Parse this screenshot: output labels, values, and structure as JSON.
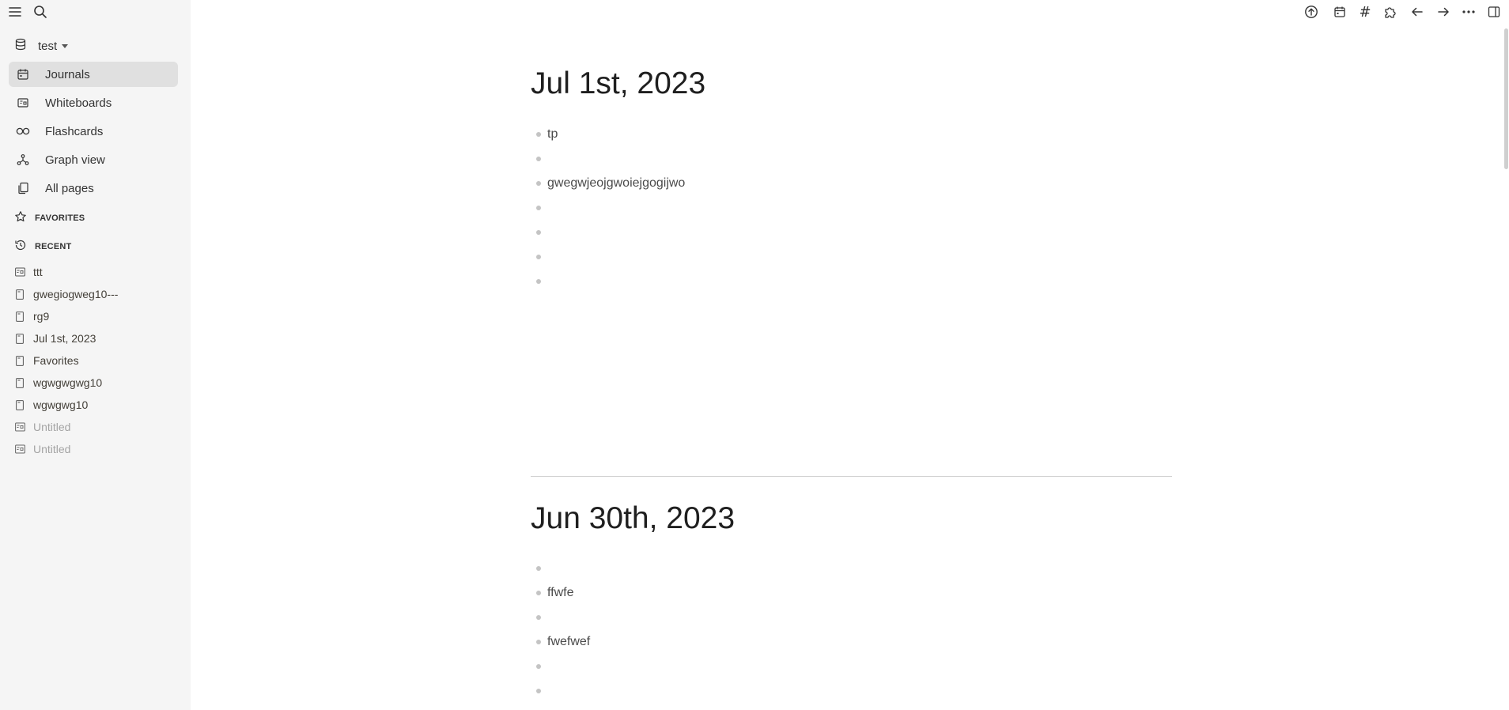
{
  "sidebar": {
    "workspace": {
      "name": "test"
    },
    "nav": [
      {
        "label": "Journals",
        "icon": "calendar-icon",
        "active": true
      },
      {
        "label": "Whiteboards",
        "icon": "whiteboard-icon",
        "active": false
      },
      {
        "label": "Flashcards",
        "icon": "infinity-icon",
        "active": false
      },
      {
        "label": "Graph view",
        "icon": "graph-icon",
        "active": false
      },
      {
        "label": "All pages",
        "icon": "pages-icon",
        "active": false
      }
    ],
    "favorites_label": "FAVORITES",
    "recent_label": "RECENT",
    "recent": [
      {
        "label": "ttt",
        "icon": "whiteboard-icon"
      },
      {
        "label": "gwegiogweg10---",
        "icon": "page-icon"
      },
      {
        "label": "rg9",
        "icon": "page-icon"
      },
      {
        "label": "Jul 1st, 2023",
        "icon": "page-icon"
      },
      {
        "label": "Favorites",
        "icon": "page-icon"
      },
      {
        "label": "wgwgwgwg10",
        "icon": "page-icon"
      },
      {
        "label": "wgwgwg10",
        "icon": "page-icon"
      },
      {
        "label": "Untitled",
        "icon": "whiteboard-icon"
      },
      {
        "label": "Untitled",
        "icon": "whiteboard-icon"
      }
    ]
  },
  "toolbar": {
    "buttons": [
      "sync-icon",
      "calendar-icon",
      "hash-icon",
      "puzzle-icon",
      "arrow-left-icon",
      "arrow-right-icon",
      "more-icon",
      "sidebar-toggle-icon"
    ],
    "hash_glyph": "#"
  },
  "journals": [
    {
      "title": "Jul 1st, 2023",
      "blocks": [
        "tp",
        "",
        "gwegwjeojgwoiejgogijwo",
        "",
        "",
        "",
        ""
      ]
    },
    {
      "title": "Jun 30th, 2023",
      "blocks": [
        "",
        "ffwfe",
        "",
        "fwefwef",
        "",
        ""
      ]
    }
  ]
}
